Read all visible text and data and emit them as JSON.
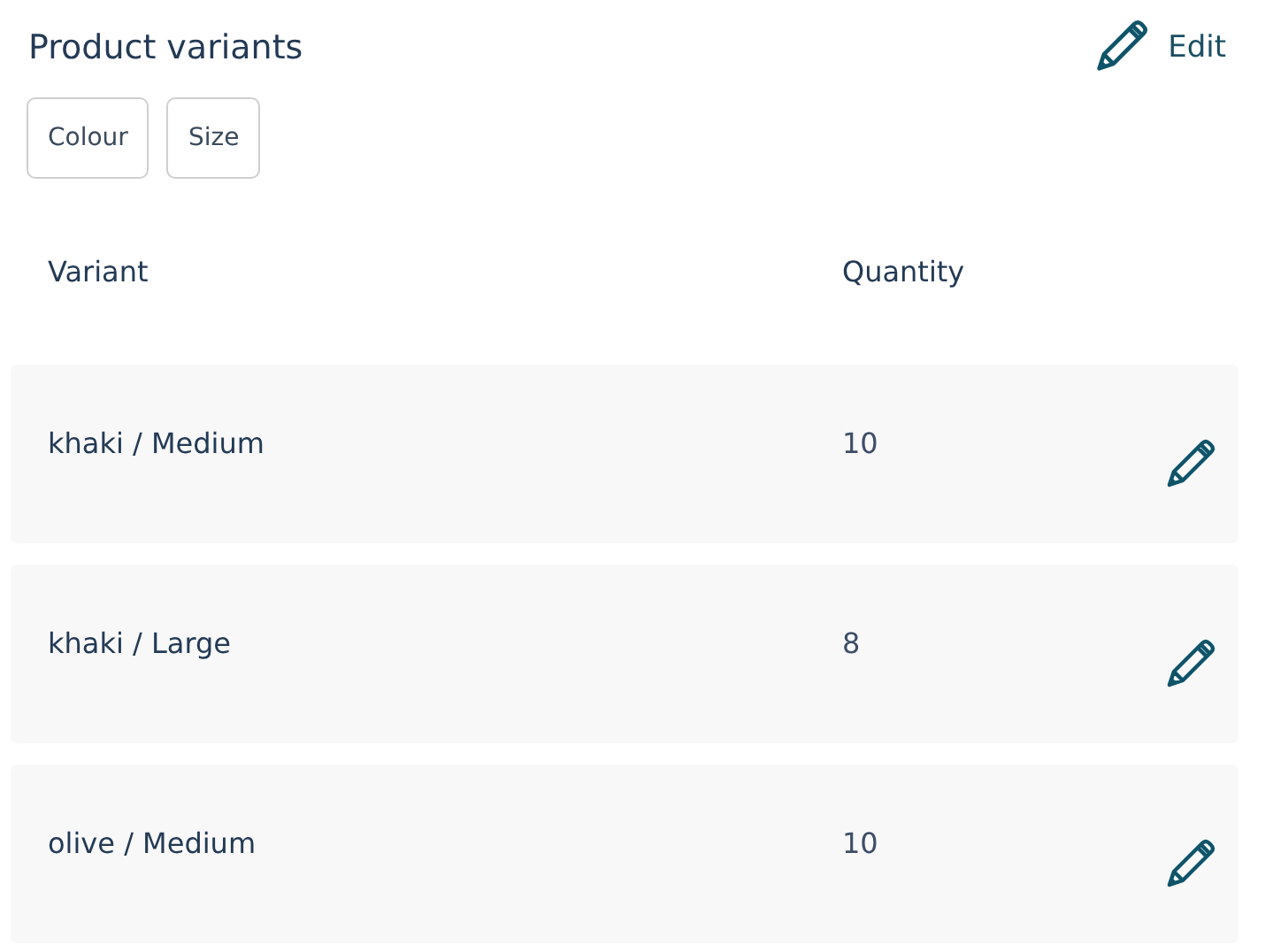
{
  "title": "Product variants",
  "edit_label": "Edit",
  "options": [
    "Colour",
    "Size"
  ],
  "columns": [
    "Variant",
    "Quantity"
  ],
  "rows": [
    {
      "variant": "khaki / Medium",
      "quantity": "10"
    },
    {
      "variant": "khaki / Large",
      "quantity": "8"
    },
    {
      "variant": "olive / Medium",
      "quantity": "10"
    }
  ]
}
